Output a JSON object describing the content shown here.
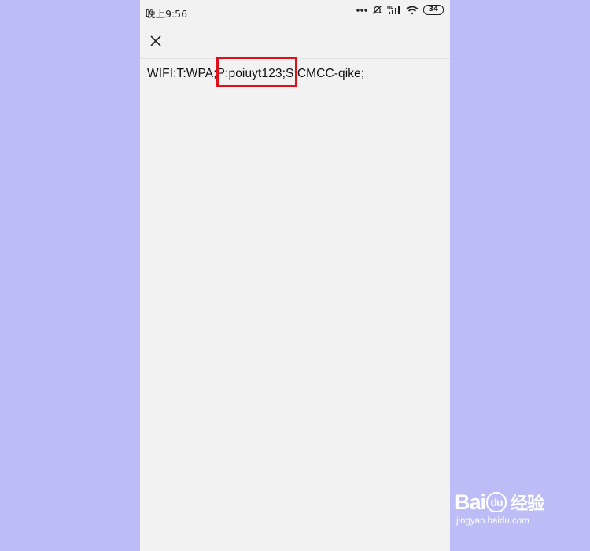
{
  "status_bar": {
    "time": "晚上9:56",
    "battery": "34",
    "network_badge": "HD",
    "icons": [
      "more-dots-icon",
      "mute-icon",
      "signal-icon",
      "wifi-icon",
      "battery-icon"
    ]
  },
  "nav": {
    "close_icon": "close-icon"
  },
  "content": {
    "wifi_text": "WIFI:T:WPA;P:poiuyt123;S:CMCC-qike;"
  },
  "annotation": {
    "highlight_color": "#e0101a"
  },
  "watermark": {
    "brand_left": "Bai",
    "brand_mark": "du",
    "brand_cn": "经验",
    "url": "jingyan.baidu.com"
  },
  "colors": {
    "background": "#bcbcf6",
    "screen": "#f2f2f2"
  }
}
